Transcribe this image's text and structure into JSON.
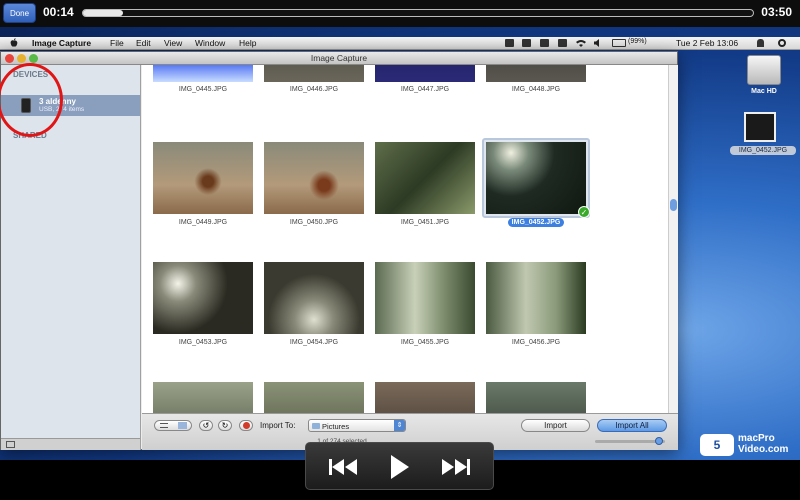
{
  "player": {
    "done_label": "Done",
    "time_elapsed": "00:14",
    "time_total": "03:50",
    "progress_fraction": 0.06
  },
  "menubar": {
    "items": [
      "Image Capture",
      "File",
      "Edit",
      "View",
      "Window",
      "Help"
    ],
    "battery": "(99%)",
    "clock": "Tue 2 Feb  13:06"
  },
  "window": {
    "title": "Image Capture",
    "sidebar": {
      "devices_header": "DEVICES",
      "device_name": "3 aldenny",
      "device_sub": "USB, 274 items",
      "shared_header": "SHARED"
    },
    "thumbnails": [
      "IMG_0445.JPG",
      "IMG_0446.JPG",
      "IMG_0447.JPG",
      "IMG_0448.JPG",
      "IMG_0449.JPG",
      "IMG_0450.JPG",
      "IMG_0451.JPG",
      "IMG_0452.JPG",
      "IMG_0453.JPG",
      "IMG_0454.JPG",
      "IMG_0455.JPG",
      "IMG_0456.JPG"
    ],
    "selected_thumbnail": "IMG_0452.JPG",
    "import_to_label": "Import To:",
    "import_destination": "Pictures",
    "import_button": "Import",
    "import_all_button": "Import All",
    "selection_status": "1 of 274 selected"
  },
  "desktop": {
    "hd_label": "Mac HD",
    "file_label": "IMG_0452.JPG",
    "logo_mark": "5",
    "logo_line1": "macPro",
    "logo_line2": "Video.com"
  },
  "icons": [
    "apple-icon",
    "rewind-icon",
    "play-icon",
    "fast-forward-icon",
    "folder-icon",
    "checkmark-icon",
    "hard-drive-icon"
  ],
  "colors": {
    "accent": "#3d80df",
    "annotation": "#e01515",
    "check": "#3aaa2a"
  }
}
